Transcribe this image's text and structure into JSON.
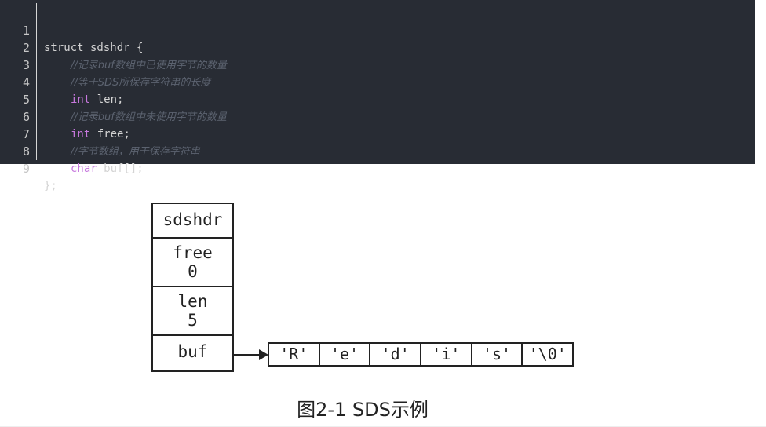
{
  "code": {
    "lines": [
      {
        "n": "1",
        "kw": "",
        "text": "struct sdshdr {",
        "comment": ""
      },
      {
        "n": "2",
        "kw": "",
        "text": "",
        "comment": "//记录buf数组中已使用字节的数量"
      },
      {
        "n": "3",
        "kw": "",
        "text": "",
        "comment": "//等于SDS所保存字符串的长度"
      },
      {
        "n": "4",
        "kw": "int",
        "text": " len;",
        "comment": ""
      },
      {
        "n": "5",
        "kw": "",
        "text": "",
        "comment": "//记录buf数组中未使用字节的数量"
      },
      {
        "n": "6",
        "kw": "int",
        "text": " free;",
        "comment": ""
      },
      {
        "n": "7",
        "kw": "",
        "text": "",
        "comment": "//字节数组，用于保存字符串"
      },
      {
        "n": "8",
        "kw": "char",
        "text": " buf[];",
        "comment": ""
      },
      {
        "n": "9",
        "kw": "",
        "text": "};",
        "comment": ""
      }
    ]
  },
  "diagram": {
    "struct": {
      "title": "sdshdr",
      "free_label": "free",
      "free_value": "0",
      "len_label": "len",
      "len_value": "5",
      "buf_label": "buf"
    },
    "buf_cells": [
      "'R'",
      "'e'",
      "'d'",
      "'i'",
      "'s'",
      "'\\0'"
    ],
    "caption": "图2-1 SDS示例"
  }
}
